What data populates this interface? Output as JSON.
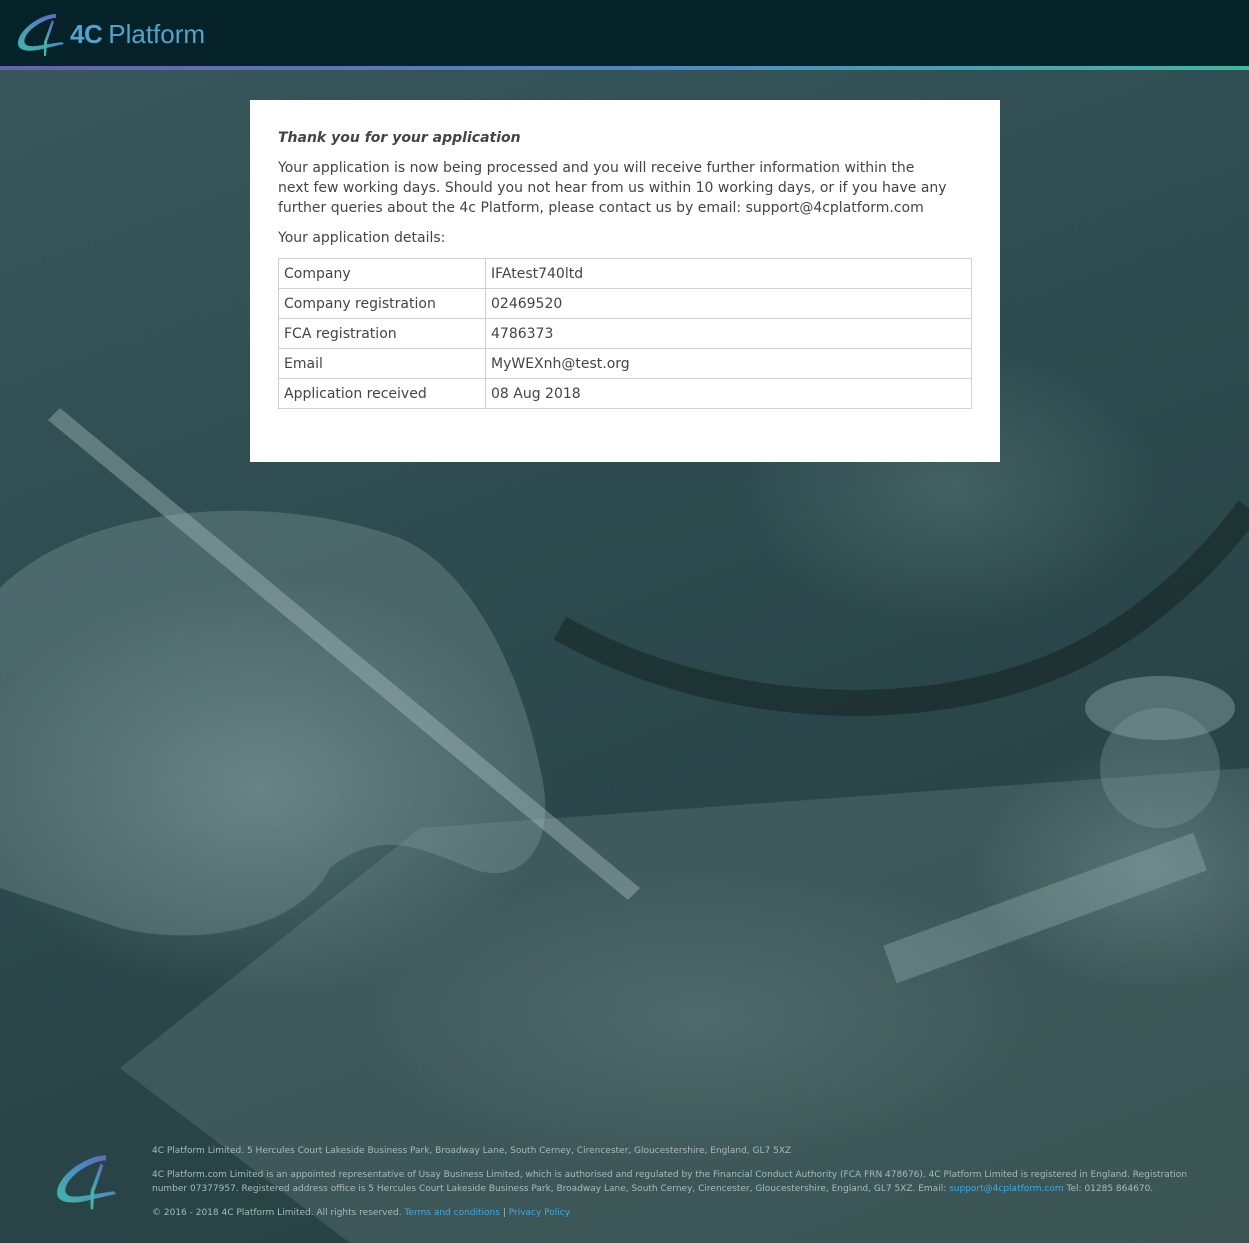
{
  "brand": {
    "logo_icon": "4c-logo-icon",
    "name_bold": "4C",
    "name_light": "Platform",
    "accent_color": "#4fa4d0"
  },
  "card": {
    "title": "Thank you for your application",
    "message": "Your application is now being processed and you will receive further information within the next few working days. Should you not hear from us within 10 working days, or if you have any further queries about the 4c Platform, please contact us by email: support@4cplatform.com",
    "details_label": "Your application details:",
    "details": [
      {
        "key": "Company",
        "value": "IFAtest740ltd"
      },
      {
        "key": "Company registration",
        "value": "02469520"
      },
      {
        "key": "FCA registration",
        "value": "4786373"
      },
      {
        "key": "Email",
        "value": "MyWEXnh@test.org"
      },
      {
        "key": "Application received",
        "value": "08 Aug 2018"
      }
    ]
  },
  "footer": {
    "address": "4C Platform Limited. 5 Hercules Court Lakeside Business Park, Broadway Lane, South Cerney, Cirencester, Gloucestershire, England, GL7 5XZ",
    "regulatory": "4C Platform.com Limited is an appointed representative of Usay Business Limited, which is authorised and regulated by the Financial Conduct Authority (FCA FRN 478676). 4C Platform Limited is registered in England. Registration number 07377957. Registered address office is 5 Hercules Court Lakeside Business Park, Broadway Lane, South Cerney, Cirencester, Gloucestershire, England, GL7 5XZ. Email:",
    "email_link": "support@4cplatform.com",
    "tel": "Tel: 01285 864670.",
    "copyright": "© 2016 - 2018 4C Platform Limited. All rights reserved.",
    "terms_link": "Terms and conditions",
    "separator": "|",
    "privacy_link": "Privacy Policy",
    "link_color": "#3fa9e0"
  }
}
